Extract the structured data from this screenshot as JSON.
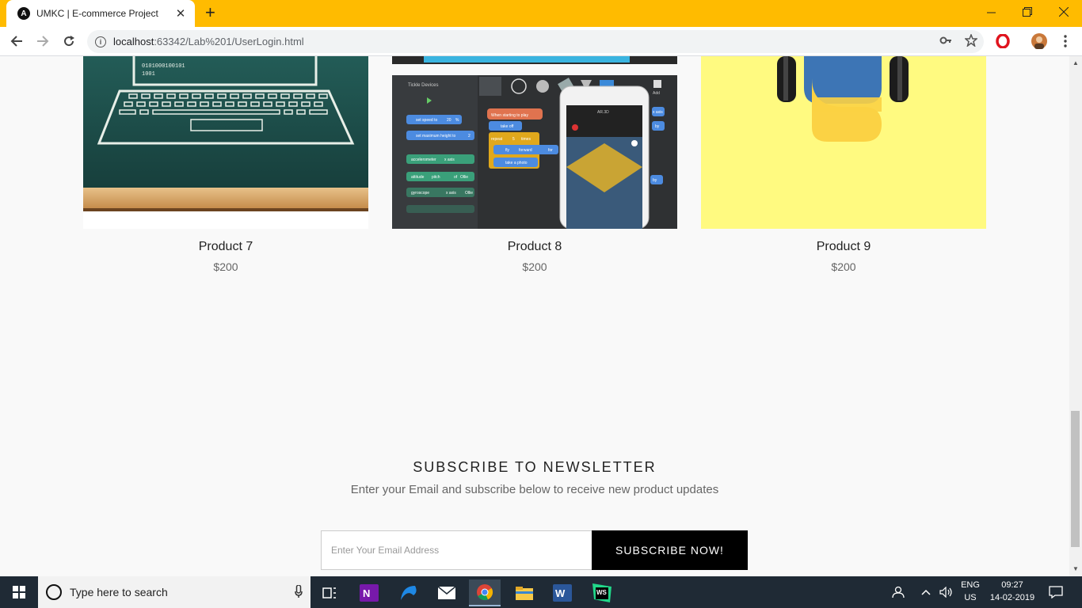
{
  "browser": {
    "tab_title": "UMKC | E-commerce Project",
    "tab_favicon": "A",
    "url_host": "localhost",
    "url_path": ":63342/Lab%201/UserLogin.html"
  },
  "products": [
    {
      "name": "Product 7",
      "price": "$200"
    },
    {
      "name": "Product 8",
      "price": "$200"
    },
    {
      "name": "Product 9",
      "price": "$200"
    }
  ],
  "product8_image": {
    "panel_title": "Tickle Devices",
    "blocks": {
      "when_start": "When starting to play",
      "take_off": "take off",
      "repeat": "repeat",
      "repeat_count": "5",
      "times": "times",
      "fly": "fly",
      "forward": "forward",
      "for": "for",
      "take_photo": "take a photo",
      "set_speed": "set speed to",
      "set_speed_val": "20",
      "percent": "%",
      "set_height": "set maximum height to",
      "set_height_val": "2",
      "accelerometer": "accelerometer",
      "x_axis": "x axis",
      "attitude": "attitude",
      "pitch": "pitch",
      "gyroscope": "gyroscope",
      "of": "of",
      "ollie": "Ollie"
    },
    "phone_title": "AR.3D",
    "side_labels": [
      "x axis",
      "by",
      "by"
    ],
    "add_label": "Add"
  },
  "product7_image": {
    "binary_line1": "0101000100101",
    "binary_line2": "1001"
  },
  "newsletter": {
    "title": "SUBSCRIBE TO NEWSLETTER",
    "subtitle": "Enter your Email and subscribe below to receive new product updates",
    "email_placeholder": "Enter Your Email Address",
    "button_label": "SUBSCRIBE NOW!"
  },
  "taskbar": {
    "search_placeholder": "Type here to search",
    "lang_line1": "ENG",
    "lang_line2": "US",
    "time": "09:27",
    "date": "14-02-2019"
  },
  "colors": {
    "titlebar": "#ffbb00",
    "chalkboard": "#1d4f4b",
    "product9_bg": "#fffa80",
    "subscribe_bg": "#000000",
    "taskbar": "#1f2a35"
  }
}
